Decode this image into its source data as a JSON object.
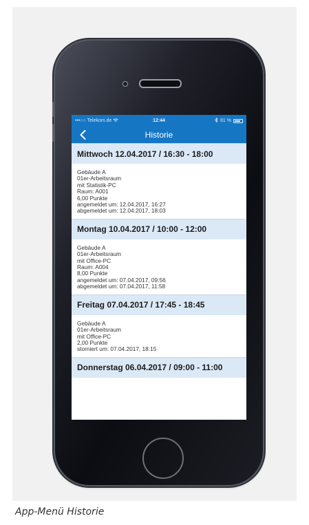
{
  "status_bar": {
    "carrier": "•••○○ Telekom.de",
    "wifi_icon": "wifi-icon",
    "time": "12:44",
    "bluetooth_icon": "bluetooth-icon",
    "battery_percent": "81 %",
    "battery_level": 0.81
  },
  "nav": {
    "back_icon": "chevron-left-icon",
    "title": "Historie"
  },
  "entries": [
    {
      "header": "Mittwoch 12.04.2017 / 16:30 - 18:00",
      "lines": [
        "Gebäude A",
        "01er-Arbeitsraum",
        "mit Statistik-PC",
        "Raum: A001",
        "6,00 Punkte",
        "angemeldet um: 12.04.2017, 16:27",
        "abgemeldet um: 12.04.2017, 18:03"
      ]
    },
    {
      "header": "Montag 10.04.2017 / 10:00 - 12:00",
      "lines": [
        "Gebäude A",
        "01er-Arbeitsraum",
        "mit Office-PC",
        "Raum: A004",
        "8,00 Punkte",
        "angemeldet um: 07.04.2017, 09:56",
        "abgemeldet um: 07.04.2017, 11:58"
      ]
    },
    {
      "header": "Freitag 07.04.2017 / 17:45 - 18:45",
      "lines": [
        "Gebäude A",
        "01er-Arbeitsraum",
        "mit Office-PC",
        "2,00 Punkte",
        "storniert um: 07.04.2017, 18:15"
      ]
    },
    {
      "header": "Donnerstag 06.04.2017 / 09:00 - 11:00",
      "lines": []
    }
  ],
  "caption": "App-Menü Historie",
  "colors": {
    "accent": "#1576c4",
    "header_bg": "#dbe9f7"
  }
}
